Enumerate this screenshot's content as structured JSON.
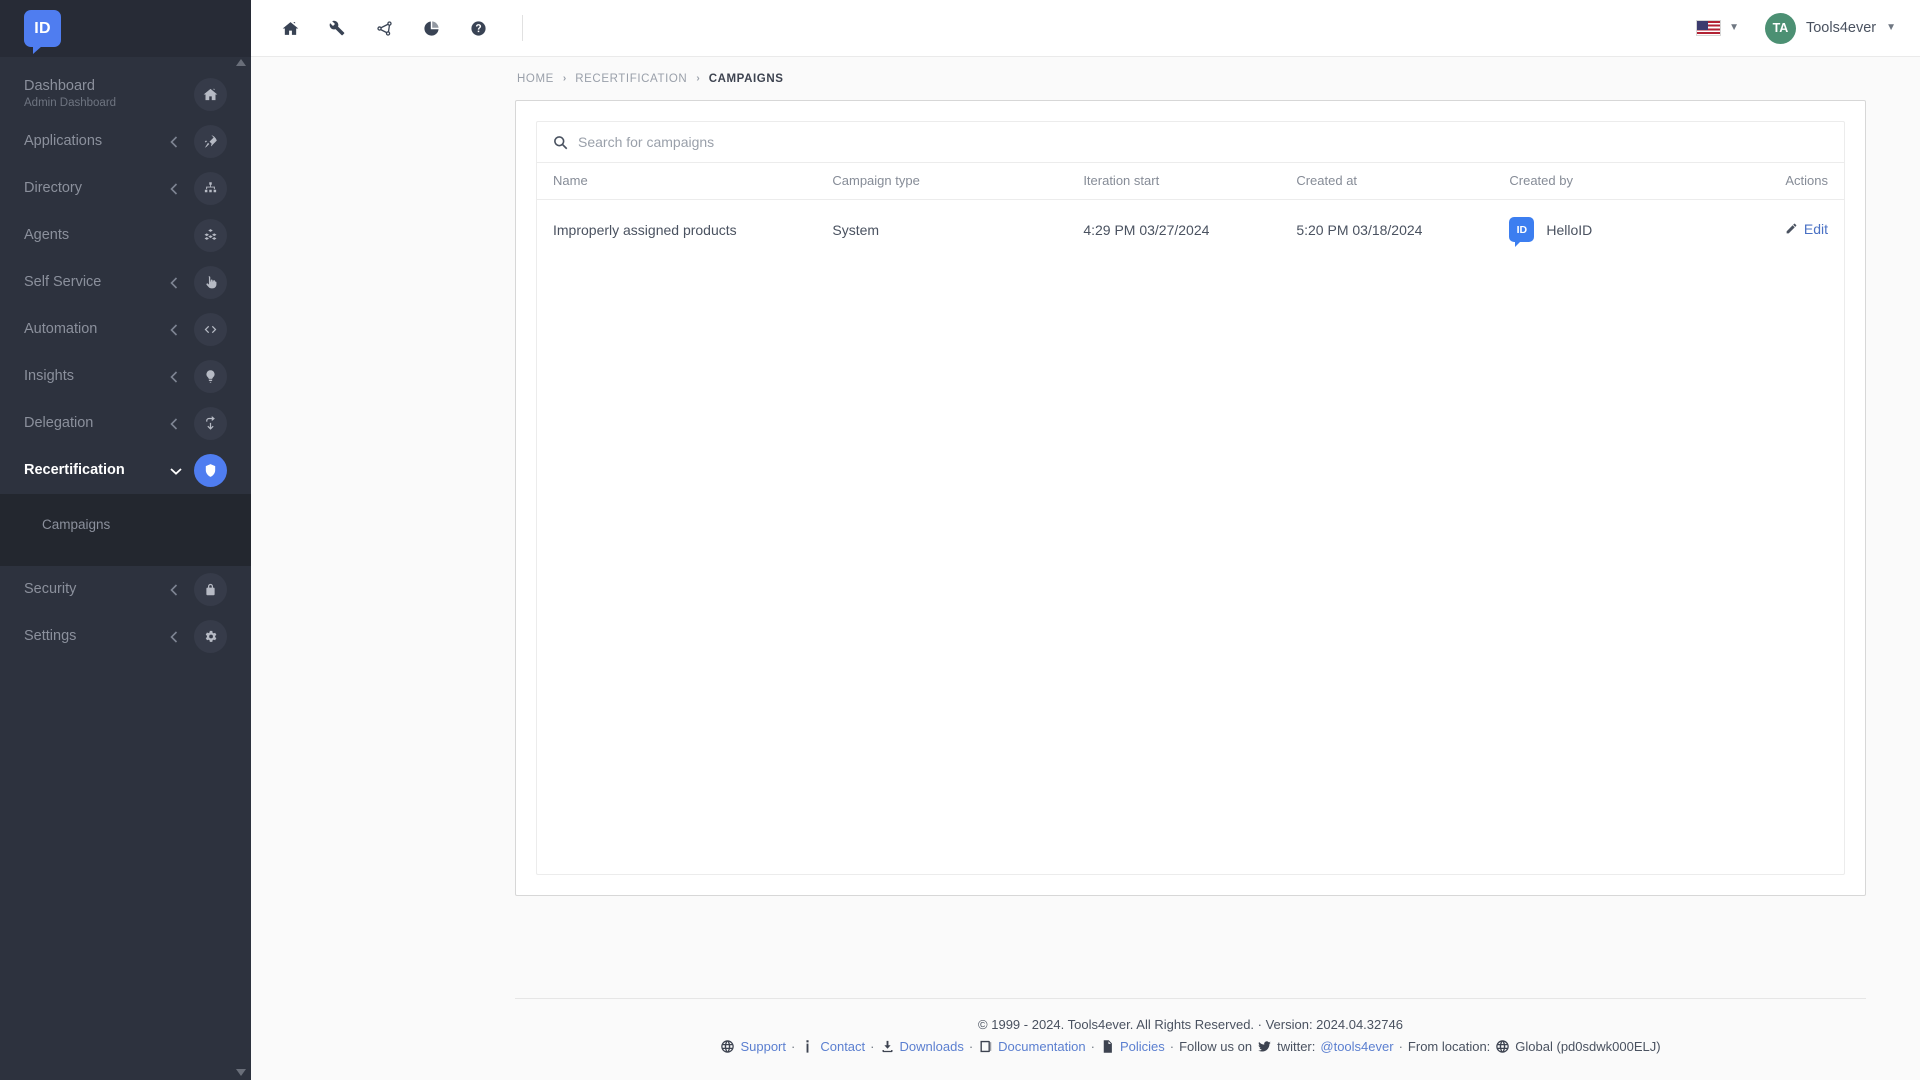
{
  "brand": {
    "logo_text": "ID",
    "accent_color": "#4f7df0",
    "sidebar_color": "#2d323e",
    "avatar_color": "#4c9073"
  },
  "sidebar": {
    "items": [
      {
        "label": "Dashboard",
        "sublabel": "Admin Dashboard",
        "icon": "home-icon",
        "caret": "none",
        "active": false
      },
      {
        "label": "Applications",
        "sublabel": "",
        "icon": "rocket-icon",
        "caret": "left",
        "active": false
      },
      {
        "label": "Directory",
        "sublabel": "",
        "icon": "sitemap-icon",
        "caret": "left",
        "active": false
      },
      {
        "label": "Agents",
        "sublabel": "",
        "icon": "cubes-icon",
        "caret": "none",
        "active": false
      },
      {
        "label": "Self Service",
        "sublabel": "",
        "icon": "hand-pointer-icon",
        "caret": "left",
        "active": false
      },
      {
        "label": "Automation",
        "sublabel": "",
        "icon": "code-icon",
        "caret": "left",
        "active": false
      },
      {
        "label": "Insights",
        "sublabel": "",
        "icon": "lightbulb-icon",
        "caret": "left",
        "active": false
      },
      {
        "label": "Delegation",
        "sublabel": "",
        "icon": "arrow-turn-icon",
        "caret": "left",
        "active": false
      },
      {
        "label": "Recertification",
        "sublabel": "",
        "icon": "shield-icon",
        "caret": "down",
        "active": true
      }
    ],
    "submenu": [
      {
        "label": "Campaigns"
      }
    ],
    "items_after": [
      {
        "label": "Security",
        "sublabel": "",
        "icon": "lock-icon",
        "caret": "left",
        "active": false
      },
      {
        "label": "Settings",
        "sublabel": "",
        "icon": "gear-icon",
        "caret": "left",
        "active": false
      }
    ]
  },
  "topbar": {
    "tools": [
      {
        "name": "home-icon"
      },
      {
        "name": "wrench-icon"
      },
      {
        "name": "share-nodes-icon"
      },
      {
        "name": "pie-chart-icon"
      },
      {
        "name": "help-circle-icon"
      }
    ],
    "language": "en-US",
    "user_initials": "TA",
    "user_name": "Tools4ever"
  },
  "breadcrumb": {
    "items": [
      {
        "label": "HOME",
        "current": false
      },
      {
        "label": "RECERTIFICATION",
        "current": false
      },
      {
        "label": "CAMPAIGNS",
        "current": true
      }
    ],
    "separator": "›"
  },
  "search": {
    "placeholder": "Search for campaigns",
    "value": "",
    "icon": "search-icon"
  },
  "table": {
    "columns": [
      "Name",
      "Campaign type",
      "Iteration start",
      "Created at",
      "Created by",
      "Actions"
    ],
    "rows": [
      {
        "name": "Improperly assigned products",
        "campaign_type": "System",
        "iteration_start": "4:29 PM 03/27/2024",
        "created_at": "5:20 PM 03/18/2024",
        "created_by": "HelloID",
        "created_by_logo": "ID",
        "action_label": "Edit"
      }
    ]
  },
  "footer": {
    "copyright": "© 1999 - 2024. Tools4ever. All Rights Reserved. · Version: 2024.04.32746",
    "links": [
      {
        "label": "Support",
        "icon": "globe-icon"
      },
      {
        "label": "Contact",
        "icon": "info-icon"
      },
      {
        "label": "Downloads",
        "icon": "download-icon"
      },
      {
        "label": "Documentation",
        "icon": "book-icon"
      },
      {
        "label": "Policies",
        "icon": "file-icon"
      }
    ],
    "follow_text": "Follow us on",
    "twitter_label": "twitter:",
    "twitter_handle": "@tools4ever",
    "location_prefix": "From location:",
    "location_value": "Global (pd0sdwk000ELJ)",
    "separator": "·"
  }
}
